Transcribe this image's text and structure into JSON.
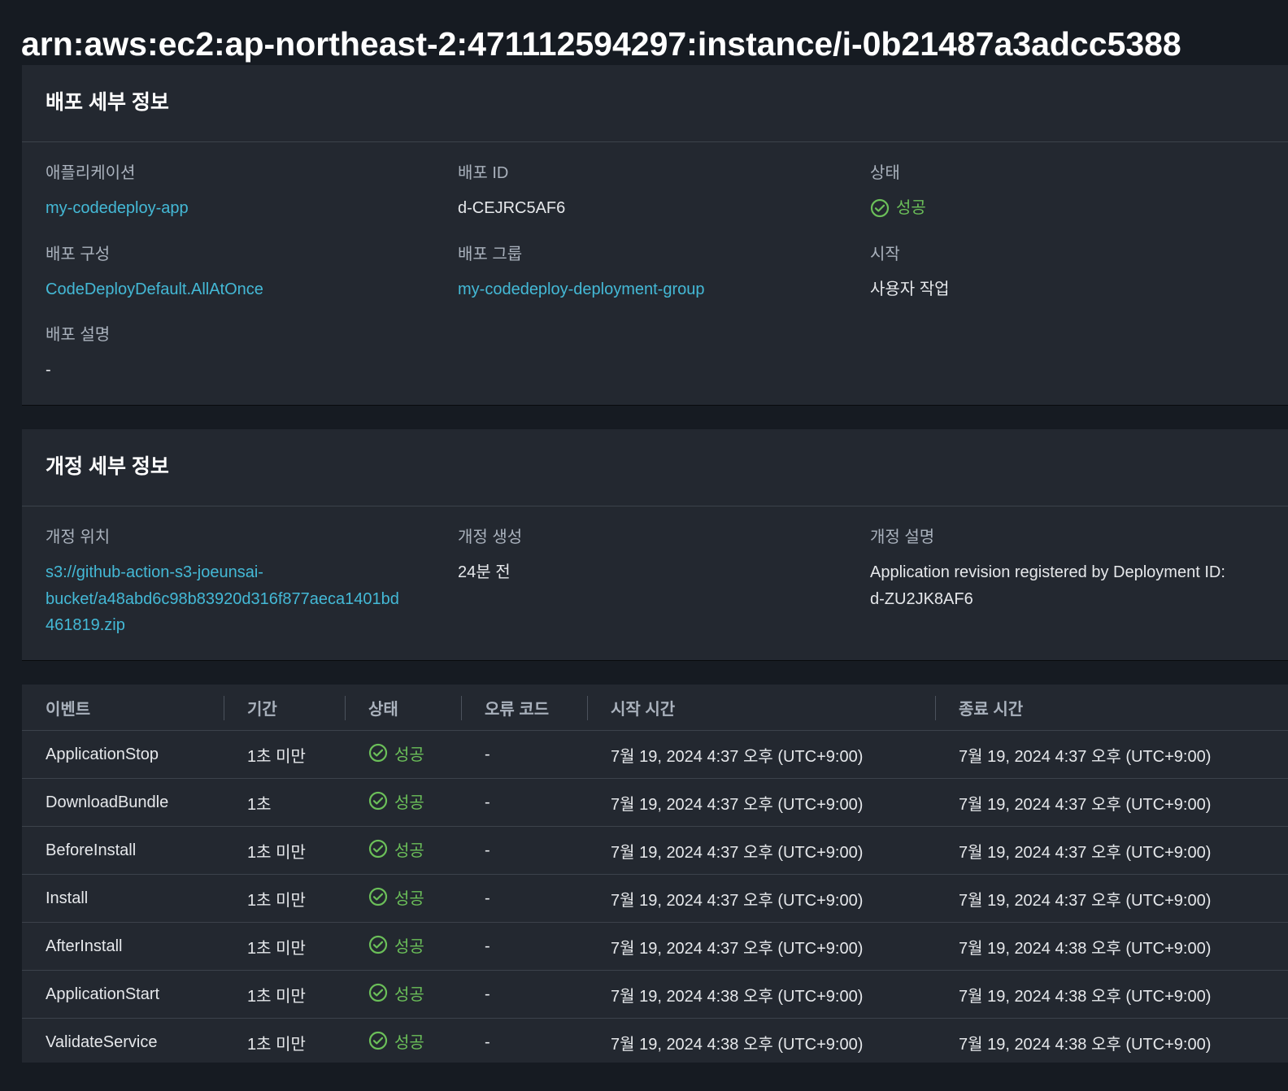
{
  "page": {
    "title": "arn:aws:ec2:ap-northeast-2:471112594297:instance/i-0b21487a3adcc5388"
  },
  "colors": {
    "background": "#161b22",
    "panel": "#232830",
    "link": "#44b9d6",
    "success": "#6bbf59"
  },
  "deployment": {
    "heading": "배포 세부 정보",
    "application_label": "애플리케이션",
    "application_value": "my-codedeploy-app",
    "deployment_id_label": "배포 ID",
    "deployment_id_value": "d-CEJRC5AF6",
    "status_label": "상태",
    "status_value": "성공",
    "config_label": "배포 구성",
    "config_value": "CodeDeployDefault.AllAtOnce",
    "group_label": "배포 그룹",
    "group_value": "my-codedeploy-deployment-group",
    "initiated_label": "시작",
    "initiated_value": "사용자 작업",
    "description_label": "배포 설명",
    "description_value": "-"
  },
  "revision": {
    "heading": "개정 세부 정보",
    "location_label": "개정 위치",
    "location_value_line1": "s3://github-action-s3-joeunsai-",
    "location_value_line2": "bucket/a48abd6c98b83920d316f877aeca1401bd",
    "location_value_line3": "461819.zip",
    "created_label": "개정 생성",
    "created_value": "24분 전",
    "description_label": "개정 설명",
    "description_line1": "Application revision registered by Deployment ID:",
    "description_line2": "d-ZU2JK8AF6"
  },
  "events_table": {
    "columns": [
      "이벤트",
      "기간",
      "상태",
      "오류 코드",
      "시작 시간",
      "종료 시간"
    ],
    "rows": [
      {
        "event": "ApplicationStop",
        "duration": "1초 미만",
        "status": "성공",
        "error": "-",
        "start": "7월 19, 2024 4:37 오후 (UTC+9:00)",
        "end": "7월 19, 2024 4:37 오후 (UTC+9:00)"
      },
      {
        "event": "DownloadBundle",
        "duration": "1초",
        "status": "성공",
        "error": "-",
        "start": "7월 19, 2024 4:37 오후 (UTC+9:00)",
        "end": "7월 19, 2024 4:37 오후 (UTC+9:00)"
      },
      {
        "event": "BeforeInstall",
        "duration": "1초 미만",
        "status": "성공",
        "error": "-",
        "start": "7월 19, 2024 4:37 오후 (UTC+9:00)",
        "end": "7월 19, 2024 4:37 오후 (UTC+9:00)"
      },
      {
        "event": "Install",
        "duration": "1초 미만",
        "status": "성공",
        "error": "-",
        "start": "7월 19, 2024 4:37 오후 (UTC+9:00)",
        "end": "7월 19, 2024 4:37 오후 (UTC+9:00)"
      },
      {
        "event": "AfterInstall",
        "duration": "1초 미만",
        "status": "성공",
        "error": "-",
        "start": "7월 19, 2024 4:37 오후 (UTC+9:00)",
        "end": "7월 19, 2024 4:38 오후 (UTC+9:00)"
      },
      {
        "event": "ApplicationStart",
        "duration": "1초 미만",
        "status": "성공",
        "error": "-",
        "start": "7월 19, 2024 4:38 오후 (UTC+9:00)",
        "end": "7월 19, 2024 4:38 오후 (UTC+9:00)"
      },
      {
        "event": "ValidateService",
        "duration": "1초 미만",
        "status": "성공",
        "error": "-",
        "start": "7월 19, 2024 4:38 오후 (UTC+9:00)",
        "end": "7월 19, 2024 4:38 오후 (UTC+9:00)"
      }
    ]
  }
}
